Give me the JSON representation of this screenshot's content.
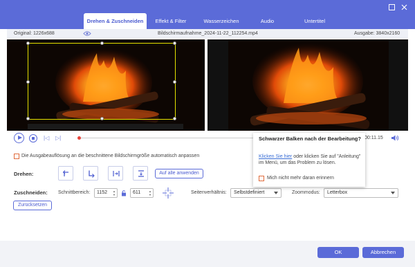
{
  "tabs": [
    {
      "label": "Drehen & Zuschneiden"
    },
    {
      "label": "Effekt & Filter"
    },
    {
      "label": "Wasserzeichen"
    },
    {
      "label": "Audio"
    },
    {
      "label": "Untertitel"
    }
  ],
  "active_tab_index": 0,
  "info": {
    "original": "Original: 1226x688",
    "filename": "Bildschirmaufnahme_2024-11-22_112254.mp4",
    "output": "Ausgabe: 3840x2160"
  },
  "player": {
    "time": "00:11.15"
  },
  "auto_adjust": {
    "label": "Die Ausgabeauflösung an die beschnittene Bildschirmgröße automatisch anpassen",
    "checked": false
  },
  "rotate": {
    "label": "Drehen:",
    "apply_all": "Auf alle anwenden"
  },
  "crop": {
    "label": "Zuschneiden:",
    "area_label": "Schnittbereich:",
    "width": "1152",
    "height": "611",
    "aspect_label": "Seitenverhältnis:",
    "aspect_value": "Selbstdefiniert",
    "zoom_label": "Zoommodus:",
    "zoom_value": "Letterbox",
    "reset": "Zurücksetzen"
  },
  "popup": {
    "title": "Schwarzer Balken nach der Bearbeitung?",
    "link": "Klicken Sie hier",
    "text": " oder klicken Sie auf \"Anleitung\" im Menü, um das Problem zu lösen.",
    "dont_remind": "Mich nicht mehr daran erinnern"
  },
  "footer": {
    "ok": "OK",
    "cancel": "Abbrechen"
  },
  "colors": {
    "accent": "#5b6bd8",
    "crop_border": "#e6e200",
    "timeline_marker": "#e8453c",
    "checkbox_border": "#e06b3b"
  },
  "icons": [
    "eye-icon",
    "play-icon",
    "stop-icon",
    "prev-frame-icon",
    "next-frame-icon",
    "volume-icon",
    "rotate-left-icon",
    "rotate-right-icon",
    "flip-horizontal-icon",
    "flip-vertical-icon",
    "lock-icon",
    "center-crop-icon",
    "minimize-icon",
    "close-icon"
  ]
}
